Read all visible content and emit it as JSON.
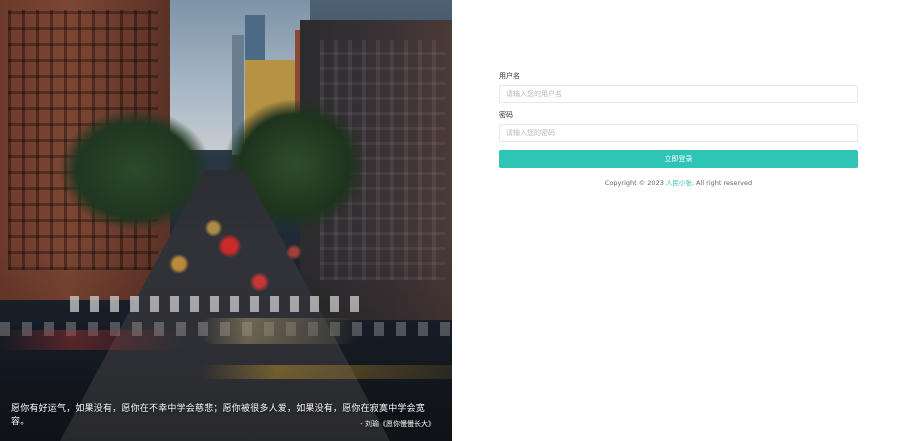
{
  "hero": {
    "quote": "愿你有好运气，如果没有，愿你在不幸中学会慈悲；愿你被很多人爱，如果没有，愿你在寂寞中学会宽容。",
    "source": "- 刘瑜《愿你慢慢长大》"
  },
  "login": {
    "username_label": "用户名",
    "username_placeholder": "请输入您的用户名",
    "password_label": "密码",
    "password_placeholder": "请输入您的密码",
    "submit_label": "立即登录"
  },
  "footer": {
    "copyright_prefix": "Copyright © 2023 ",
    "brand": "人民小张",
    "copyright_suffix": ". All right reserved"
  },
  "colors": {
    "accent": "#2ec4b6"
  }
}
